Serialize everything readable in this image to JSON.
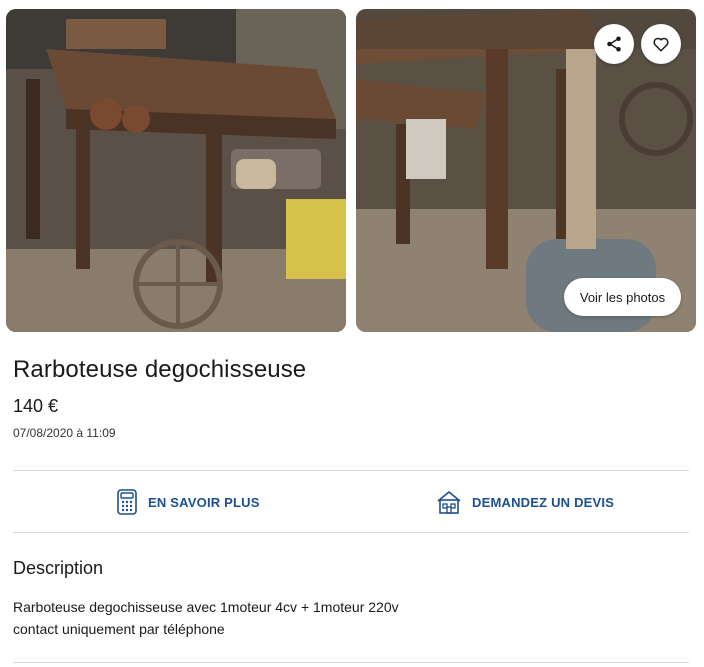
{
  "listing": {
    "title": "Rarboteuse degochisseuse",
    "price": "140 €",
    "date": "07/08/2020 à 11:09"
  },
  "gallery": {
    "see_photos_label": "Voir les photos",
    "share_icon": "share-icon",
    "favorite_icon": "heart-icon"
  },
  "actions": {
    "info_label": "EN SAVOIR PLUS",
    "info_icon": "calculator-icon",
    "quote_label": "DEMANDEZ UN DEVIS",
    "quote_icon": "house-icon"
  },
  "description": {
    "heading": "Description",
    "lines": [
      "Rarboteuse degochisseuse avec 1moteur 4cv + 1moteur 220v",
      "contact uniquement par téléphone"
    ]
  },
  "colors": {
    "accent": "#1d4f91",
    "divider": "#d9d9d9"
  }
}
